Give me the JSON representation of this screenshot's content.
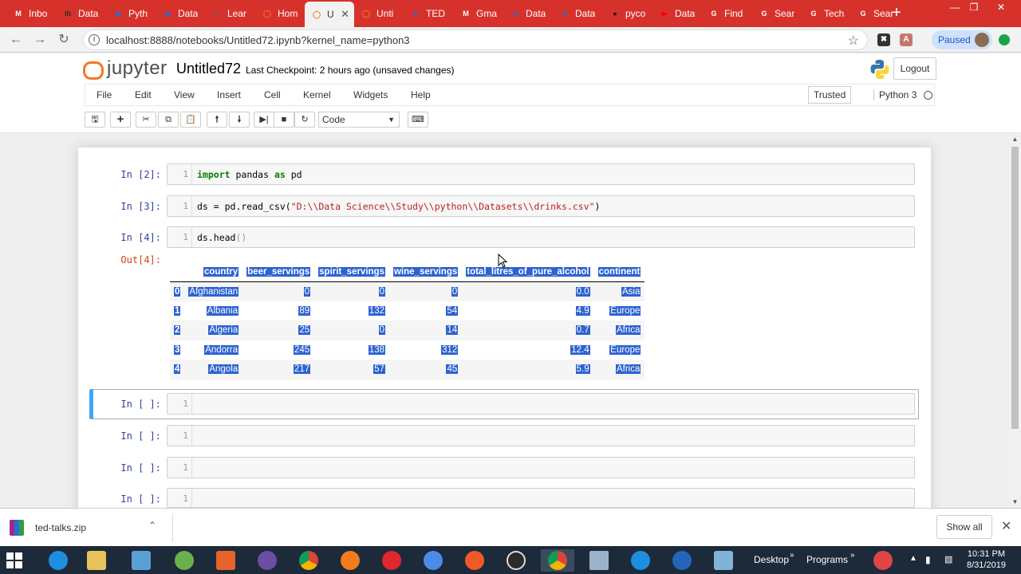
{
  "browser": {
    "tabs": [
      {
        "label": "Inbo",
        "icon": "gmail-icon",
        "color": "#ffffff",
        "glyph": "M"
      },
      {
        "label": "Data",
        "icon": "in-icon",
        "color": "#2a2a2a",
        "glyph": "ih"
      },
      {
        "label": "Pyth",
        "icon": "shield-icon",
        "color": "#2b6ed3",
        "glyph": "◆"
      },
      {
        "label": "Data",
        "icon": "shield-icon",
        "color": "#2b6ed3",
        "glyph": "◆"
      },
      {
        "label": "Lear",
        "icon": "globe-icon",
        "color": "#666666",
        "glyph": "●"
      },
      {
        "label": "Hom",
        "icon": "jupyter-icon",
        "color": "#f37726",
        "glyph": "◯"
      },
      {
        "label": "U",
        "icon": "jupyter-icon",
        "color": "#f37726",
        "glyph": "◯"
      },
      {
        "label": "Unti",
        "icon": "jupyter-icon",
        "color": "#f37726",
        "glyph": "◯"
      },
      {
        "label": "TED",
        "icon": "k-icon",
        "color": "#2b6ed3",
        "glyph": "k"
      },
      {
        "label": "Gma",
        "icon": "gmail-icon",
        "color": "#ffffff",
        "glyph": "M"
      },
      {
        "label": "Data",
        "icon": "doc-icon",
        "color": "#2b6ed3",
        "glyph": "d"
      },
      {
        "label": "Data",
        "icon": "doc-icon",
        "color": "#2b6ed3",
        "glyph": "d"
      },
      {
        "label": "pyco",
        "icon": "github-icon",
        "color": "#111111",
        "glyph": "●"
      },
      {
        "label": "Data",
        "icon": "youtube-icon",
        "color": "#ff0000",
        "glyph": "▶"
      },
      {
        "label": "Find",
        "icon": "g-icon",
        "color": "#ffffff",
        "glyph": "G"
      },
      {
        "label": "Sear",
        "icon": "g-icon",
        "color": "#ffffff",
        "glyph": "G"
      },
      {
        "label": "Tech",
        "icon": "g-icon",
        "color": "#ffffff",
        "glyph": "G"
      },
      {
        "label": "Sear",
        "icon": "g-icon",
        "color": "#ffffff",
        "glyph": "G"
      }
    ],
    "active_tab_index": 6,
    "url": "localhost:8888/notebooks/Untitled72.ipynb?kernel_name=python3",
    "profile_status": "Paused",
    "new_tab": "+"
  },
  "jupyter": {
    "logo_text": "jupyter",
    "notebook_name": "Untitled72",
    "checkpoint": "Last Checkpoint: 2 hours ago (unsaved changes)",
    "logout": "Logout",
    "menu": [
      "File",
      "Edit",
      "View",
      "Insert",
      "Cell",
      "Kernel",
      "Widgets",
      "Help"
    ],
    "trusted": "Trusted",
    "kernel": "Python 3",
    "cell_type": "Code"
  },
  "cells": [
    {
      "prompt": "In [2]:",
      "line": "1"
    },
    {
      "prompt": "In [3]:",
      "line": "1"
    },
    {
      "prompt": "In [4]:",
      "line": "1"
    },
    {
      "prompt": "In [ ]:",
      "line": "1"
    },
    {
      "prompt": "In [ ]:",
      "line": "1"
    },
    {
      "prompt": "In [ ]:",
      "line": "1"
    },
    {
      "prompt": "In [ ]:",
      "line": "1"
    }
  ],
  "code": {
    "c2_import": "import",
    "c2_mid": " pandas ",
    "c2_as": "as",
    "c2_end": " pd",
    "c3_pre": "ds = pd.read_csv(",
    "c3_str": "\"D:\\\\Data Science\\\\Study\\\\python\\\\Datasets\\\\drinks.csv\"",
    "c3_post": ")",
    "c4_pre": "ds.head",
    "c4_paren": "()"
  },
  "output": {
    "prompt": "Out[4]:",
    "columns": [
      "country",
      "beer_servings",
      "spirit_servings",
      "wine_servings",
      "total_litres_of_pure_alcohol",
      "continent"
    ],
    "rows": [
      {
        "index": "0",
        "country": "Afghanistan",
        "beer": "0",
        "spirit": "0",
        "wine": "0",
        "alcohol": "0.0",
        "continent": "Asia"
      },
      {
        "index": "1",
        "country": "Albania",
        "beer": "89",
        "spirit": "132",
        "wine": "54",
        "alcohol": "4.9",
        "continent": "Europe"
      },
      {
        "index": "2",
        "country": "Algeria",
        "beer": "25",
        "spirit": "0",
        "wine": "14",
        "alcohol": "0.7",
        "continent": "Africa"
      },
      {
        "index": "3",
        "country": "Andorra",
        "beer": "245",
        "spirit": "138",
        "wine": "312",
        "alcohol": "12.4",
        "continent": "Europe"
      },
      {
        "index": "4",
        "country": "Angola",
        "beer": "217",
        "spirit": "57",
        "wine": "45",
        "alcohol": "5.9",
        "continent": "Africa"
      }
    ]
  },
  "downloads": {
    "file": "ted-talks.zip",
    "show_all": "Show all"
  },
  "taskbar": {
    "desktop": "Desktop",
    "programs": "Programs",
    "time": "10:31 PM",
    "date": "8/31/2019"
  }
}
